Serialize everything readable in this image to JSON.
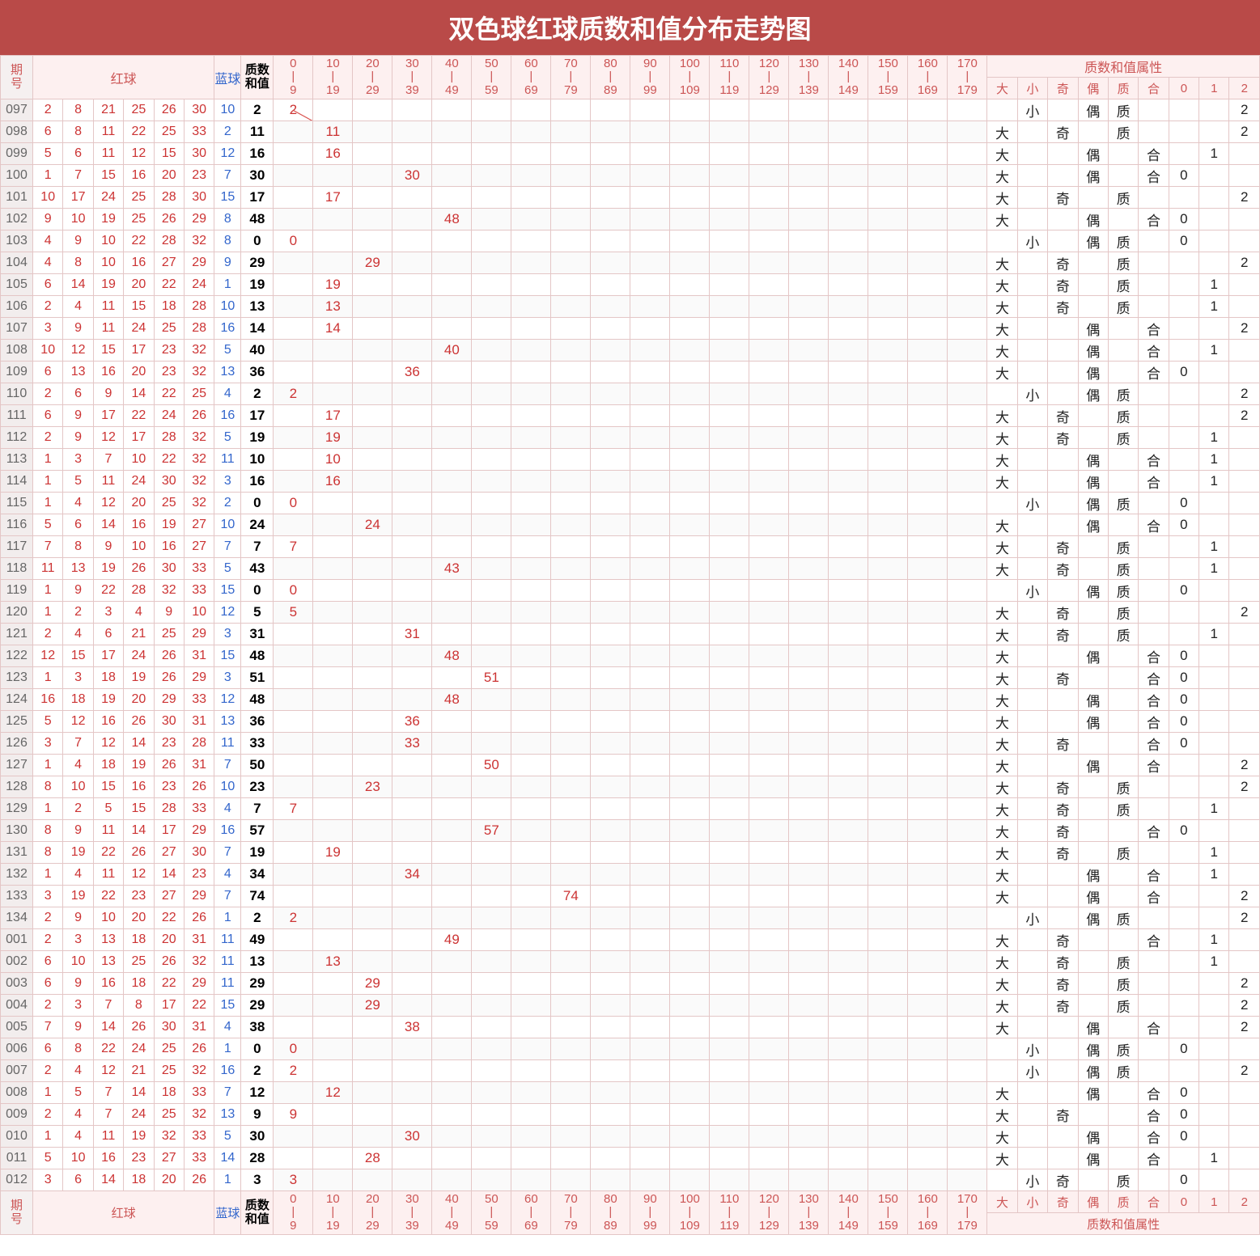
{
  "title": "双色球红球质数和值分布走势图",
  "headers": {
    "period": "期\n号",
    "red": "红球",
    "blue": "蓝球",
    "sum": "质数\n和值",
    "ranges": [
      "0\n|\n9",
      "10\n|\n19",
      "20\n|\n29",
      "30\n|\n39",
      "40\n|\n49",
      "50\n|\n59",
      "60\n|\n69",
      "70\n|\n79",
      "80\n|\n89",
      "90\n|\n99",
      "100\n|\n109",
      "110\n|\n119",
      "120\n|\n129",
      "130\n|\n139",
      "140\n|\n149",
      "150\n|\n159",
      "160\n|\n169",
      "170\n|\n179"
    ],
    "propGroup": "质数和值属性",
    "props": [
      "大",
      "小",
      "奇",
      "偶",
      "质",
      "合",
      "0",
      "1",
      "2"
    ]
  },
  "chart_data": {
    "type": "table",
    "title": "双色球红球质数和值分布走势图",
    "bin_ranges": [
      [
        0,
        9
      ],
      [
        10,
        19
      ],
      [
        20,
        29
      ],
      [
        30,
        39
      ],
      [
        40,
        49
      ],
      [
        50,
        59
      ],
      [
        60,
        69
      ],
      [
        70,
        79
      ],
      [
        80,
        89
      ],
      [
        90,
        99
      ],
      [
        100,
        109
      ],
      [
        110,
        119
      ],
      [
        120,
        129
      ],
      [
        130,
        139
      ],
      [
        140,
        149
      ],
      [
        150,
        159
      ],
      [
        160,
        169
      ],
      [
        170,
        179
      ]
    ],
    "rows": [
      {
        "period": "097",
        "red": [
          2,
          8,
          21,
          25,
          26,
          30
        ],
        "blue": 10,
        "sum": 2,
        "bin": 0,
        "props": [
          "",
          "小",
          "",
          "偶",
          "质",
          "",
          "",
          "",
          "2"
        ]
      },
      {
        "period": "098",
        "red": [
          6,
          8,
          11,
          22,
          25,
          33
        ],
        "blue": 2,
        "sum": 11,
        "bin": 1,
        "props": [
          "大",
          "",
          "奇",
          "",
          "质",
          "",
          "",
          "",
          "2"
        ]
      },
      {
        "period": "099",
        "red": [
          5,
          6,
          11,
          12,
          15,
          30
        ],
        "blue": 12,
        "sum": 16,
        "bin": 1,
        "props": [
          "大",
          "",
          "",
          "偶",
          "",
          "合",
          "",
          "1",
          ""
        ]
      },
      {
        "period": "100",
        "red": [
          1,
          7,
          15,
          16,
          20,
          23
        ],
        "blue": 7,
        "sum": 30,
        "bin": 3,
        "props": [
          "大",
          "",
          "",
          "偶",
          "",
          "合",
          "0",
          "",
          ""
        ]
      },
      {
        "period": "101",
        "red": [
          10,
          17,
          24,
          25,
          28,
          30
        ],
        "blue": 15,
        "sum": 17,
        "bin": 1,
        "props": [
          "大",
          "",
          "奇",
          "",
          "质",
          "",
          "",
          "",
          "2"
        ]
      },
      {
        "period": "102",
        "red": [
          9,
          10,
          19,
          25,
          26,
          29
        ],
        "blue": 8,
        "sum": 48,
        "bin": 4,
        "props": [
          "大",
          "",
          "",
          "偶",
          "",
          "合",
          "0",
          "",
          ""
        ]
      },
      {
        "period": "103",
        "red": [
          4,
          9,
          10,
          22,
          28,
          32
        ],
        "blue": 8,
        "sum": 0,
        "bin": 0,
        "props": [
          "",
          "小",
          "",
          "偶",
          "质",
          "",
          "0",
          "",
          ""
        ]
      },
      {
        "period": "104",
        "red": [
          4,
          8,
          10,
          16,
          27,
          29
        ],
        "blue": 9,
        "sum": 29,
        "bin": 2,
        "props": [
          "大",
          "",
          "奇",
          "",
          "质",
          "",
          "",
          "",
          "2"
        ]
      },
      {
        "period": "105",
        "red": [
          6,
          14,
          19,
          20,
          22,
          24
        ],
        "blue": 1,
        "sum": 19,
        "bin": 1,
        "props": [
          "大",
          "",
          "奇",
          "",
          "质",
          "",
          "",
          "1",
          ""
        ]
      },
      {
        "period": "106",
        "red": [
          2,
          4,
          11,
          15,
          18,
          28
        ],
        "blue": 10,
        "sum": 13,
        "bin": 1,
        "props": [
          "大",
          "",
          "奇",
          "",
          "质",
          "",
          "",
          "1",
          ""
        ]
      },
      {
        "period": "107",
        "red": [
          3,
          9,
          11,
          24,
          25,
          28
        ],
        "blue": 16,
        "sum": 14,
        "bin": 1,
        "props": [
          "大",
          "",
          "",
          "偶",
          "",
          "合",
          "",
          "",
          "2"
        ]
      },
      {
        "period": "108",
        "red": [
          10,
          12,
          15,
          17,
          23,
          32
        ],
        "blue": 5,
        "sum": 40,
        "bin": 4,
        "props": [
          "大",
          "",
          "",
          "偶",
          "",
          "合",
          "",
          "1",
          ""
        ]
      },
      {
        "period": "109",
        "red": [
          6,
          13,
          16,
          20,
          23,
          32
        ],
        "blue": 13,
        "sum": 36,
        "bin": 3,
        "props": [
          "大",
          "",
          "",
          "偶",
          "",
          "合",
          "0",
          "",
          ""
        ]
      },
      {
        "period": "110",
        "red": [
          2,
          6,
          9,
          14,
          22,
          25
        ],
        "blue": 4,
        "sum": 2,
        "bin": 0,
        "props": [
          "",
          "小",
          "",
          "偶",
          "质",
          "",
          "",
          "",
          "2"
        ]
      },
      {
        "period": "111",
        "red": [
          6,
          9,
          17,
          22,
          24,
          26
        ],
        "blue": 16,
        "sum": 17,
        "bin": 1,
        "props": [
          "大",
          "",
          "奇",
          "",
          "质",
          "",
          "",
          "",
          "2"
        ]
      },
      {
        "period": "112",
        "red": [
          2,
          9,
          12,
          17,
          28,
          32
        ],
        "blue": 5,
        "sum": 19,
        "bin": 1,
        "props": [
          "大",
          "",
          "奇",
          "",
          "质",
          "",
          "",
          "1",
          ""
        ]
      },
      {
        "period": "113",
        "red": [
          1,
          3,
          7,
          10,
          22,
          32
        ],
        "blue": 11,
        "sum": 10,
        "bin": 1,
        "props": [
          "大",
          "",
          "",
          "偶",
          "",
          "合",
          "",
          "1",
          ""
        ]
      },
      {
        "period": "114",
        "red": [
          1,
          5,
          11,
          24,
          30,
          32
        ],
        "blue": 3,
        "sum": 16,
        "bin": 1,
        "props": [
          "大",
          "",
          "",
          "偶",
          "",
          "合",
          "",
          "1",
          ""
        ]
      },
      {
        "period": "115",
        "red": [
          1,
          4,
          12,
          20,
          25,
          32
        ],
        "blue": 2,
        "sum": 0,
        "bin": 0,
        "props": [
          "",
          "小",
          "",
          "偶",
          "质",
          "",
          "0",
          "",
          ""
        ]
      },
      {
        "period": "116",
        "red": [
          5,
          6,
          14,
          16,
          19,
          27
        ],
        "blue": 10,
        "sum": 24,
        "bin": 2,
        "props": [
          "大",
          "",
          "",
          "偶",
          "",
          "合",
          "0",
          "",
          ""
        ]
      },
      {
        "period": "117",
        "red": [
          7,
          8,
          9,
          10,
          16,
          27
        ],
        "blue": 7,
        "sum": 7,
        "bin": 0,
        "props": [
          "大",
          "",
          "奇",
          "",
          "质",
          "",
          "",
          "1",
          ""
        ]
      },
      {
        "period": "118",
        "red": [
          11,
          13,
          19,
          26,
          30,
          33
        ],
        "blue": 5,
        "sum": 43,
        "bin": 4,
        "props": [
          "大",
          "",
          "奇",
          "",
          "质",
          "",
          "",
          "1",
          ""
        ]
      },
      {
        "period": "119",
        "red": [
          1,
          9,
          22,
          28,
          32,
          33
        ],
        "blue": 15,
        "sum": 0,
        "bin": 0,
        "props": [
          "",
          "小",
          "",
          "偶",
          "质",
          "",
          "0",
          "",
          ""
        ]
      },
      {
        "period": "120",
        "red": [
          1,
          2,
          3,
          4,
          9,
          10
        ],
        "blue": 12,
        "sum": 5,
        "bin": 0,
        "props": [
          "大",
          "",
          "奇",
          "",
          "质",
          "",
          "",
          "",
          "2"
        ]
      },
      {
        "period": "121",
        "red": [
          2,
          4,
          6,
          21,
          25,
          29
        ],
        "blue": 3,
        "sum": 31,
        "bin": 3,
        "props": [
          "大",
          "",
          "奇",
          "",
          "质",
          "",
          "",
          "1",
          ""
        ]
      },
      {
        "period": "122",
        "red": [
          12,
          15,
          17,
          24,
          26,
          31
        ],
        "blue": 15,
        "sum": 48,
        "bin": 4,
        "props": [
          "大",
          "",
          "",
          "偶",
          "",
          "合",
          "0",
          "",
          ""
        ]
      },
      {
        "period": "123",
        "red": [
          1,
          3,
          18,
          19,
          26,
          29
        ],
        "blue": 3,
        "sum": 51,
        "bin": 5,
        "props": [
          "大",
          "",
          "奇",
          "",
          "",
          "合",
          "0",
          "",
          ""
        ]
      },
      {
        "period": "124",
        "red": [
          16,
          18,
          19,
          20,
          29,
          33
        ],
        "blue": 12,
        "sum": 48,
        "bin": 4,
        "props": [
          "大",
          "",
          "",
          "偶",
          "",
          "合",
          "0",
          "",
          ""
        ]
      },
      {
        "period": "125",
        "red": [
          5,
          12,
          16,
          26,
          30,
          31
        ],
        "blue": 13,
        "sum": 36,
        "bin": 3,
        "props": [
          "大",
          "",
          "",
          "偶",
          "",
          "合",
          "0",
          "",
          ""
        ]
      },
      {
        "period": "126",
        "red": [
          3,
          7,
          12,
          14,
          23,
          28
        ],
        "blue": 11,
        "sum": 33,
        "bin": 3,
        "props": [
          "大",
          "",
          "奇",
          "",
          "",
          "合",
          "0",
          "",
          ""
        ]
      },
      {
        "period": "127",
        "red": [
          1,
          4,
          18,
          19,
          26,
          31
        ],
        "blue": 7,
        "sum": 50,
        "bin": 5,
        "props": [
          "大",
          "",
          "",
          "偶",
          "",
          "合",
          "",
          "",
          "2"
        ]
      },
      {
        "period": "128",
        "red": [
          8,
          10,
          15,
          16,
          23,
          26
        ],
        "blue": 10,
        "sum": 23,
        "bin": 2,
        "props": [
          "大",
          "",
          "奇",
          "",
          "质",
          "",
          "",
          "",
          "2"
        ]
      },
      {
        "period": "129",
        "red": [
          1,
          2,
          5,
          15,
          28,
          33
        ],
        "blue": 4,
        "sum": 7,
        "bin": 0,
        "props": [
          "大",
          "",
          "奇",
          "",
          "质",
          "",
          "",
          "1",
          ""
        ]
      },
      {
        "period": "130",
        "red": [
          8,
          9,
          11,
          14,
          17,
          29
        ],
        "blue": 16,
        "sum": 57,
        "bin": 5,
        "props": [
          "大",
          "",
          "奇",
          "",
          "",
          "合",
          "0",
          "",
          ""
        ]
      },
      {
        "period": "131",
        "red": [
          8,
          19,
          22,
          26,
          27,
          30
        ],
        "blue": 7,
        "sum": 19,
        "bin": 1,
        "props": [
          "大",
          "",
          "奇",
          "",
          "质",
          "",
          "",
          "1",
          ""
        ]
      },
      {
        "period": "132",
        "red": [
          1,
          4,
          11,
          12,
          14,
          23
        ],
        "blue": 4,
        "sum": 34,
        "bin": 3,
        "props": [
          "大",
          "",
          "",
          "偶",
          "",
          "合",
          "",
          "1",
          ""
        ]
      },
      {
        "period": "133",
        "red": [
          3,
          19,
          22,
          23,
          27,
          29
        ],
        "blue": 7,
        "sum": 74,
        "bin": 7,
        "props": [
          "大",
          "",
          "",
          "偶",
          "",
          "合",
          "",
          "",
          "2"
        ]
      },
      {
        "period": "134",
        "red": [
          2,
          9,
          10,
          20,
          22,
          26
        ],
        "blue": 1,
        "sum": 2,
        "bin": 0,
        "props": [
          "",
          "小",
          "",
          "偶",
          "质",
          "",
          "",
          "",
          "2"
        ]
      },
      {
        "period": "001",
        "red": [
          2,
          3,
          13,
          18,
          20,
          31
        ],
        "blue": 11,
        "sum": 49,
        "bin": 4,
        "props": [
          "大",
          "",
          "奇",
          "",
          "",
          "合",
          "",
          "1",
          ""
        ]
      },
      {
        "period": "002",
        "red": [
          6,
          10,
          13,
          25,
          26,
          32
        ],
        "blue": 11,
        "sum": 13,
        "bin": 1,
        "props": [
          "大",
          "",
          "奇",
          "",
          "质",
          "",
          "",
          "1",
          ""
        ]
      },
      {
        "period": "003",
        "red": [
          6,
          9,
          16,
          18,
          22,
          29
        ],
        "blue": 11,
        "sum": 29,
        "bin": 2,
        "props": [
          "大",
          "",
          "奇",
          "",
          "质",
          "",
          "",
          "",
          "2"
        ]
      },
      {
        "period": "004",
        "red": [
          2,
          3,
          7,
          8,
          17,
          22
        ],
        "blue": 15,
        "sum": 29,
        "bin": 2,
        "props": [
          "大",
          "",
          "奇",
          "",
          "质",
          "",
          "",
          "",
          "2"
        ]
      },
      {
        "period": "005",
        "red": [
          7,
          9,
          14,
          26,
          30,
          31
        ],
        "blue": 4,
        "sum": 38,
        "bin": 3,
        "props": [
          "大",
          "",
          "",
          "偶",
          "",
          "合",
          "",
          "",
          "2"
        ]
      },
      {
        "period": "006",
        "red": [
          6,
          8,
          22,
          24,
          25,
          26
        ],
        "blue": 1,
        "sum": 0,
        "bin": 0,
        "props": [
          "",
          "小",
          "",
          "偶",
          "质",
          "",
          "0",
          "",
          ""
        ]
      },
      {
        "period": "007",
        "red": [
          2,
          4,
          12,
          21,
          25,
          32
        ],
        "blue": 16,
        "sum": 2,
        "bin": 0,
        "props": [
          "",
          "小",
          "",
          "偶",
          "质",
          "",
          "",
          "",
          "2"
        ]
      },
      {
        "period": "008",
        "red": [
          1,
          5,
          7,
          14,
          18,
          33
        ],
        "blue": 7,
        "sum": 12,
        "bin": 1,
        "props": [
          "大",
          "",
          "",
          "偶",
          "",
          "合",
          "0",
          "",
          ""
        ]
      },
      {
        "period": "009",
        "red": [
          2,
          4,
          7,
          24,
          25,
          32
        ],
        "blue": 13,
        "sum": 9,
        "bin": 0,
        "props": [
          "大",
          "",
          "奇",
          "",
          "",
          "合",
          "0",
          "",
          ""
        ]
      },
      {
        "period": "010",
        "red": [
          1,
          4,
          11,
          19,
          32,
          33
        ],
        "blue": 5,
        "sum": 30,
        "bin": 3,
        "props": [
          "大",
          "",
          "",
          "偶",
          "",
          "合",
          "0",
          "",
          ""
        ]
      },
      {
        "period": "011",
        "red": [
          5,
          10,
          16,
          23,
          27,
          33
        ],
        "blue": 14,
        "sum": 28,
        "bin": 2,
        "props": [
          "大",
          "",
          "",
          "偶",
          "",
          "合",
          "",
          "1",
          ""
        ]
      },
      {
        "period": "012",
        "red": [
          3,
          6,
          14,
          18,
          20,
          26
        ],
        "blue": 1,
        "sum": 3,
        "bin": 0,
        "props": [
          "",
          "小",
          "奇",
          "",
          "质",
          "",
          "0",
          "",
          ""
        ]
      }
    ]
  }
}
